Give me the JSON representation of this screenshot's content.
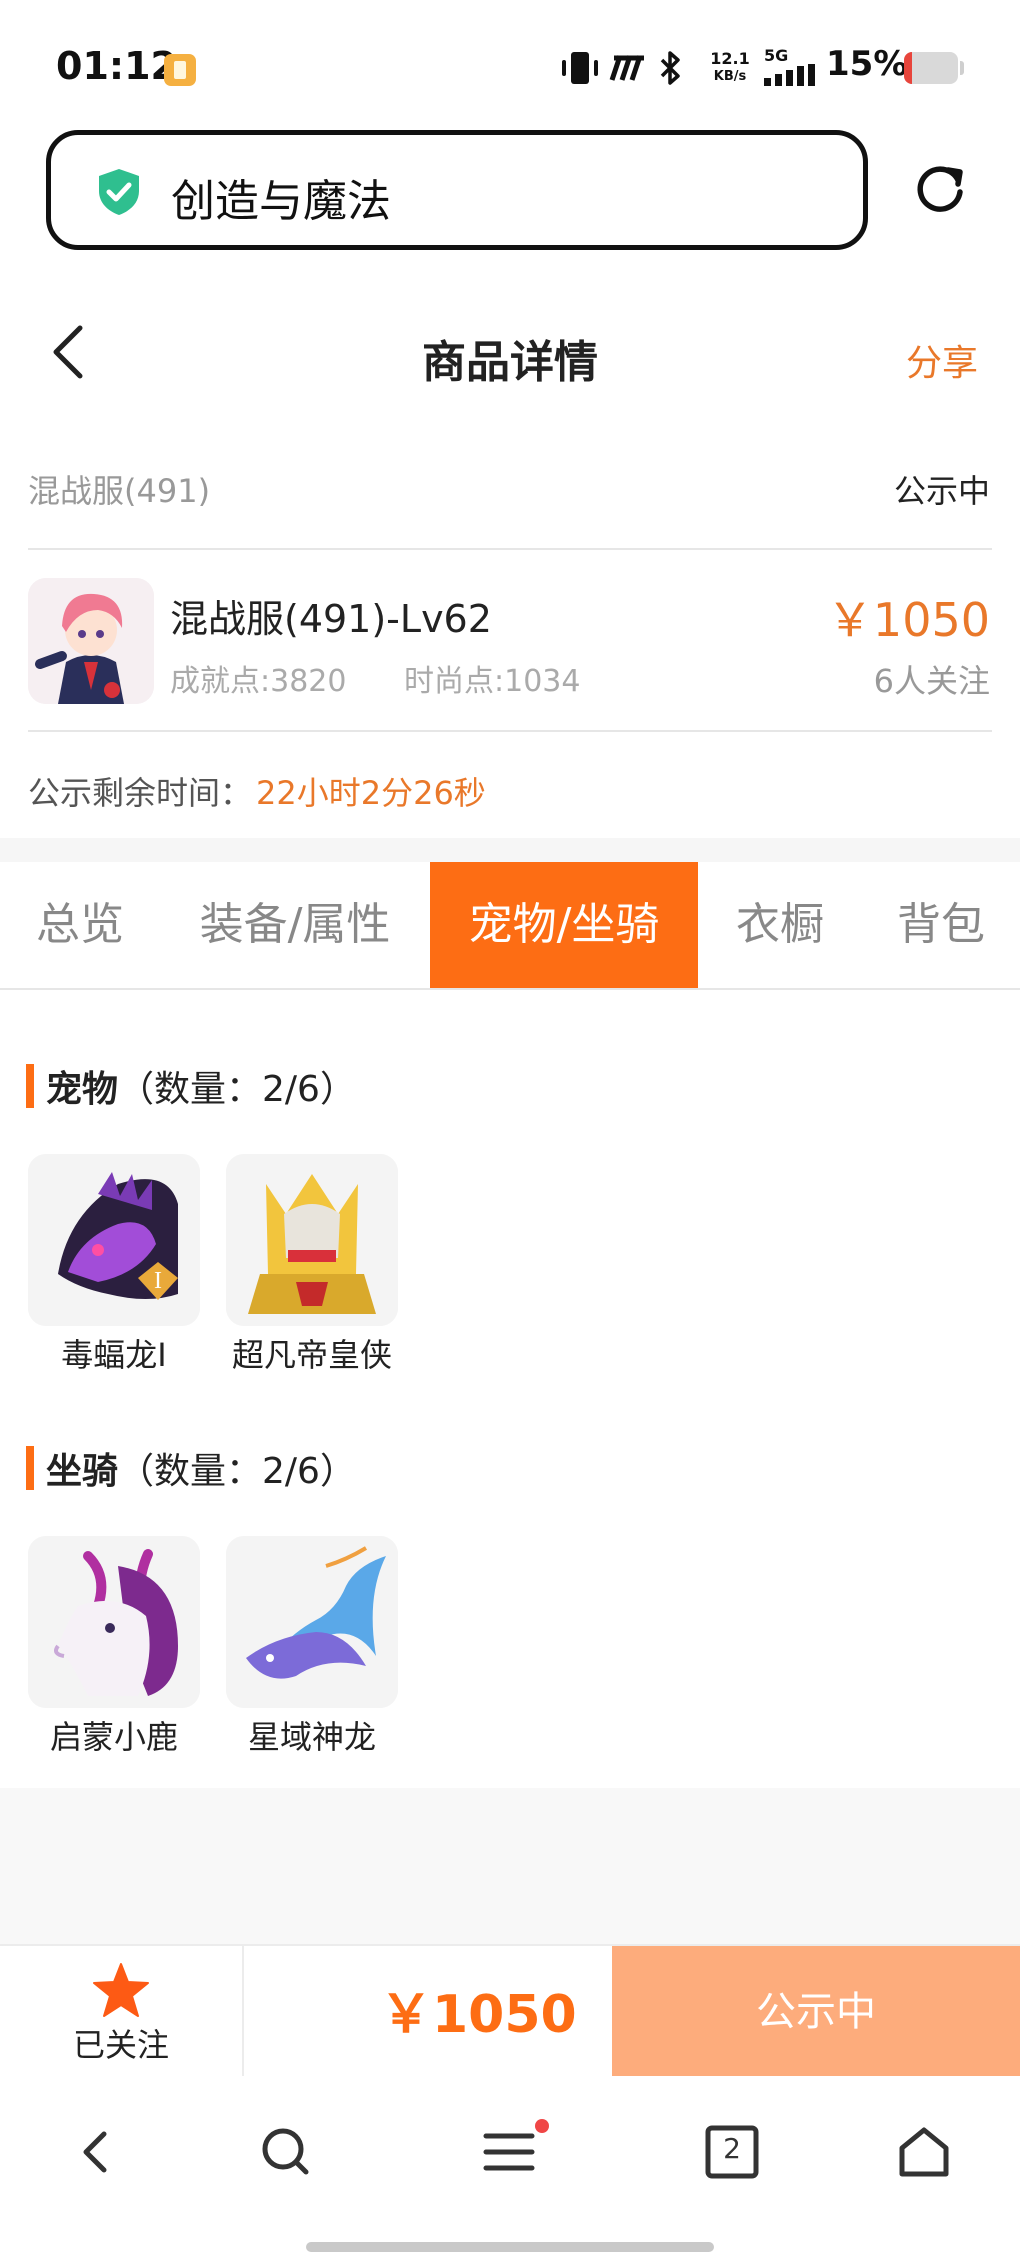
{
  "status_bar": {
    "time": "01:12",
    "net_speed_top": "12.1",
    "net_speed_bottom": "KB/s",
    "network": "5G",
    "battery_percent": "15%",
    "battery_level": 0.15
  },
  "url_bar": {
    "title": "创造与魔法"
  },
  "header": {
    "title": "商品详情",
    "share_label": "分享"
  },
  "product": {
    "server": "混战服(491)",
    "status": "公示中",
    "name": "混战服(491)-Lv62",
    "achievement_points": "成就点:3820",
    "fashion_points": "时尚点:1034",
    "price": "￥1050",
    "followers": "6人关注",
    "remaining_label": "公示剩余时间：",
    "remaining_value": "22小时2分26秒"
  },
  "tabs": [
    {
      "label": "总览",
      "active": false
    },
    {
      "label": "装备/属性",
      "active": false
    },
    {
      "label": "宠物/坐骑",
      "active": true
    },
    {
      "label": "衣橱",
      "active": false
    },
    {
      "label": "背包",
      "active": false
    }
  ],
  "pets": {
    "title": "宠物",
    "count": "（数量：2/6）",
    "items": [
      {
        "name": "毒蝠龙Ⅰ"
      },
      {
        "name": "超凡帝皇侠"
      }
    ]
  },
  "mounts": {
    "title": "坐骑",
    "count": "（数量：2/6）",
    "items": [
      {
        "name": "启蒙小鹿"
      },
      {
        "name": "星域神龙"
      }
    ]
  },
  "action_bar": {
    "follow_label": "已关注",
    "price": "￥1050",
    "button_label": "公示中"
  },
  "browser_nav": {
    "tab_count": "2"
  },
  "colors": {
    "accent": "#fd6d14",
    "price_orange": "#e9782a",
    "button_disabled": "#fdac7c"
  }
}
